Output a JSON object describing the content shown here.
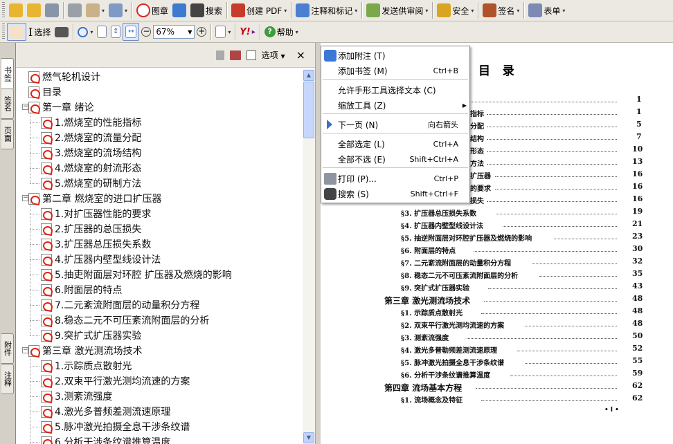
{
  "toolbar1": [
    {
      "label": "",
      "icon": "open-folder-icon"
    },
    {
      "label": "",
      "icon": "open-icon"
    },
    {
      "label": "",
      "icon": "save-icon"
    },
    {
      "label": "",
      "icon": "print-icon"
    },
    {
      "label": "",
      "icon": "email-icon"
    },
    {
      "label": "",
      "icon": "attach-icon"
    },
    {
      "label": "图章",
      "icon": "stamp-icon"
    },
    {
      "label": "",
      "icon": "globe-icon"
    },
    {
      "label": "搜索",
      "icon": "binoculars-icon"
    },
    {
      "label": "创建 PDF",
      "icon": "create-pdf-icon"
    },
    {
      "label": "注释和标记",
      "icon": "comment-icon"
    },
    {
      "label": "发送供审阅",
      "icon": "send-review-icon"
    },
    {
      "label": "安全",
      "icon": "lock-icon"
    },
    {
      "label": "签名",
      "icon": "pen-icon"
    },
    {
      "label": "表单",
      "icon": "form-icon"
    }
  ],
  "toolbar2": {
    "hand_icon": "hand-icon",
    "select_label": "选择",
    "snapshot_icon": "camera-icon",
    "zoom_in_icon": "zoom-in-icon",
    "zoom_out_icon": "minus-circle-icon",
    "zoom_plus_icon": "plus-circle-icon",
    "zoom": "67%",
    "help_label": "帮助",
    "yahoo_label": "Y!"
  },
  "sidetabs": [
    "书签",
    "签名",
    "页面",
    "附件",
    "注释"
  ],
  "panel": {
    "options_label": "选项",
    "close": "×"
  },
  "bookmarks": [
    {
      "text": "燃气轮机设计",
      "level": 0,
      "toggle": ""
    },
    {
      "text": "目录",
      "level": 0,
      "toggle": ""
    },
    {
      "text": "第一章 绪论",
      "level": 0,
      "toggle": "−"
    },
    {
      "text": "1.燃烧室的性能指标",
      "level": 1
    },
    {
      "text": "2.燃烧室的流量分配",
      "level": 1
    },
    {
      "text": "3.燃烧室的流场结构",
      "level": 1
    },
    {
      "text": "4.燃烧室的射流形态",
      "level": 1
    },
    {
      "text": "5.燃烧室的研制方法",
      "level": 1
    },
    {
      "text": "第二章 燃烧室的进口扩压器",
      "level": 0,
      "toggle": "−"
    },
    {
      "text": "1.对扩压器性能的要求",
      "level": 1
    },
    {
      "text": "2.扩压器的总压损失",
      "level": 1
    },
    {
      "text": "3.扩压器总压损失系数",
      "level": 1
    },
    {
      "text": "4.扩压器内壁型线设计法",
      "level": 1
    },
    {
      "text": "5.抽吏附面层对环腔 扩压器及燃烧的影响",
      "level": 1
    },
    {
      "text": "6.附面层的特点",
      "level": 1
    },
    {
      "text": "7.二元紊流附面层的动量积分方程",
      "level": 1
    },
    {
      "text": "8.稳态二元不可压紊流附面层的分析",
      "level": 1
    },
    {
      "text": "9.突扩式扩压器实验",
      "level": 1
    },
    {
      "text": "第三章 激光测流场技术",
      "level": 0,
      "toggle": "−"
    },
    {
      "text": "1.示踪质点散射光",
      "level": 1
    },
    {
      "text": "2.双束平行激光测均流速的方案",
      "level": 1
    },
    {
      "text": "3.测紊流强度",
      "level": 1
    },
    {
      "text": "4.激光多普频差测流速原理",
      "level": 1
    },
    {
      "text": "5.脉冲激光拍摄全息干涉条纹谱",
      "level": 1
    },
    {
      "text": "6.分析干涉条纹谱推算温度",
      "level": 1
    }
  ],
  "menu": [
    {
      "label": "添加附注 (T)",
      "shortcut": "",
      "icon": "note-icon",
      "sep_after": false
    },
    {
      "label": "添加书签 (M)",
      "shortcut": "Ctrl+B",
      "icon": "",
      "sep_after": true
    },
    {
      "label": "允许手形工具选择文本 (C)",
      "shortcut": "",
      "icon": "",
      "sep_after": false
    },
    {
      "label": "缩放工具 (Z)",
      "shortcut": "",
      "icon": "",
      "submenu": true,
      "sep_after": true
    },
    {
      "label": "下一页 (N)",
      "shortcut": "向右箭头",
      "icon": "next-page-icon",
      "sep_after": true
    },
    {
      "label": "全部选定 (L)",
      "shortcut": "Ctrl+A",
      "icon": "",
      "sep_after": false
    },
    {
      "label": "全部不选 (E)",
      "shortcut": "Shift+Ctrl+A",
      "icon": "",
      "sep_after": true
    },
    {
      "label": "打印 (P)...",
      "shortcut": "Ctrl+P",
      "icon": "print-icon",
      "sep_after": false
    },
    {
      "label": "搜索 (S)",
      "shortcut": "Shift+Ctrl+F",
      "icon": "binoculars-icon",
      "sep_after": false
    }
  ],
  "doc": {
    "title": "目   录",
    "entries": [
      {
        "text": "",
        "page": "1",
        "indent": 0
      },
      {
        "text": "指标",
        "page": "1",
        "indent": 0
      },
      {
        "text": "分配",
        "page": "5",
        "indent": 0
      },
      {
        "text": "结构",
        "page": "7",
        "indent": 0
      },
      {
        "text": "形态",
        "page": "10",
        "indent": 0
      },
      {
        "text": "方法",
        "page": "13",
        "indent": 0
      },
      {
        "text": "扩压器",
        "page": "16",
        "indent": 0
      },
      {
        "text": "的要求",
        "page": "16",
        "indent": 0
      },
      {
        "text": "损失",
        "page": "16",
        "indent": 0
      },
      {
        "text": "§3. 扩压器总压损失系数",
        "page": "19",
        "indent": 1
      },
      {
        "text": "§4. 扩压器内壁型线设计法",
        "page": "21",
        "indent": 1
      },
      {
        "text": "§5. 抽逆附面层对环腔扩压器及燃烧的影响",
        "page": "23",
        "indent": 1
      },
      {
        "text": "§6. 附面层的特点",
        "page": "30",
        "indent": 1
      },
      {
        "text": "§7. 二元紊流附面层的动量积分方程",
        "page": "32",
        "indent": 1
      },
      {
        "text": "§8. 稳态二元不可压紊流附面层的分析",
        "page": "35",
        "indent": 1
      },
      {
        "text": "§9. 突扩式扩压器实验",
        "page": "43",
        "indent": 1
      },
      {
        "text": "第三章  激光测流场技术",
        "page": "48",
        "indent": 0
      },
      {
        "text": "§1. 示踪质点散射光",
        "page": "48",
        "indent": 1
      },
      {
        "text": "§2. 双束平行激光测均流速的方案",
        "page": "48",
        "indent": 1
      },
      {
        "text": "§3. 测紊流强度",
        "page": "50",
        "indent": 1
      },
      {
        "text": "§4. 激光多普勒频差测流速原理",
        "page": "52",
        "indent": 1
      },
      {
        "text": "§5. 脉冲激光拍摄全息干涉条纹谱",
        "page": "55",
        "indent": 1
      },
      {
        "text": "§6. 分析干涉条纹谱推算温度",
        "page": "59",
        "indent": 1
      },
      {
        "text": "第四章  流场基本方程",
        "page": "62",
        "indent": 0
      },
      {
        "text": "§1. 流场概念及特征",
        "page": "62",
        "indent": 1
      }
    ],
    "footer": "• l •"
  }
}
